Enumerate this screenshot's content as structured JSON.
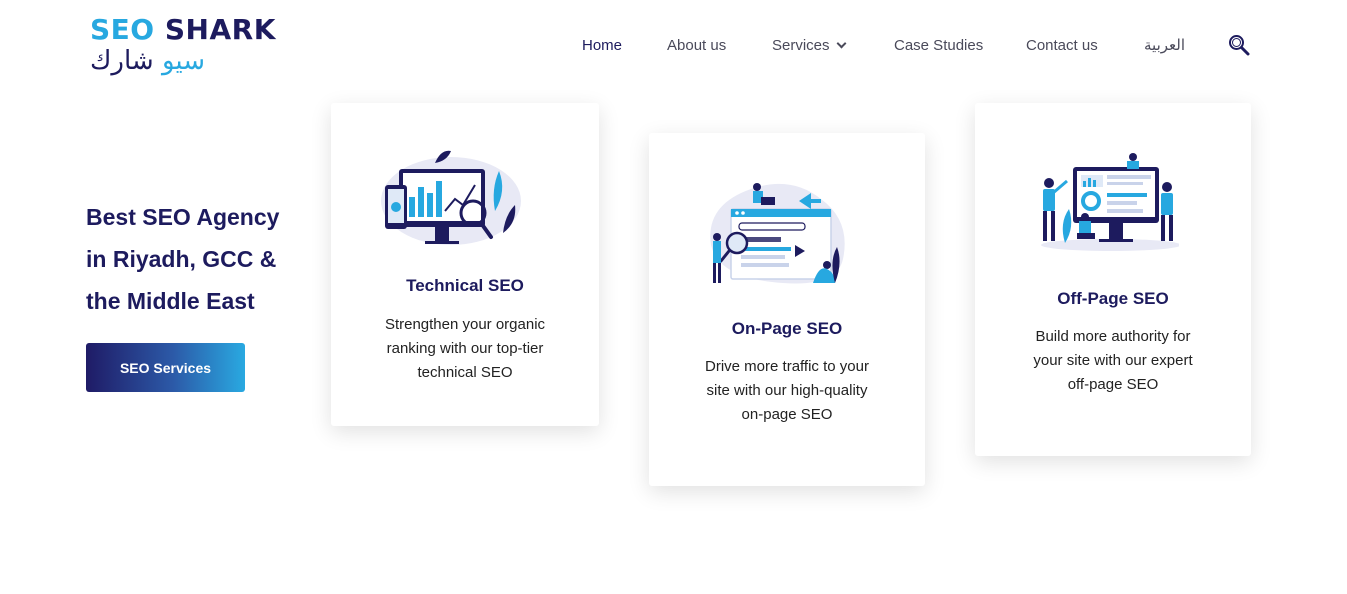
{
  "brand": {
    "logo_en_seo": "SEO",
    "logo_en_shark": "SHARK",
    "logo_ar_blue": "سيو",
    "logo_ar_dark": "شارك"
  },
  "nav": {
    "home": "Home",
    "about": "About us",
    "services": "Services",
    "case_studies": "Case Studies",
    "contact": "Contact us",
    "arabic": "العربية"
  },
  "hero": {
    "title_line1": "Best SEO Agency",
    "title_line2": "in Riyadh, GCC &",
    "title_line3": "the Middle East",
    "button": "SEO Services"
  },
  "cards": [
    {
      "title": "Technical SEO",
      "desc_line1": "Strengthen your organic",
      "desc_line2": "ranking with our top-tier",
      "desc_line3": "technical SEO"
    },
    {
      "title": "On-Page SEO",
      "desc_line1": "Drive more traffic to your",
      "desc_line2": "site with our high-quality",
      "desc_line3": "on-page SEO"
    },
    {
      "title": "Off-Page SEO",
      "desc_line1": "Build more authority for",
      "desc_line2": "your site with our expert",
      "desc_line3": "off-page SEO"
    }
  ],
  "colors": {
    "brand_dark": "#1d1b5e",
    "brand_blue": "#27a8e0"
  }
}
